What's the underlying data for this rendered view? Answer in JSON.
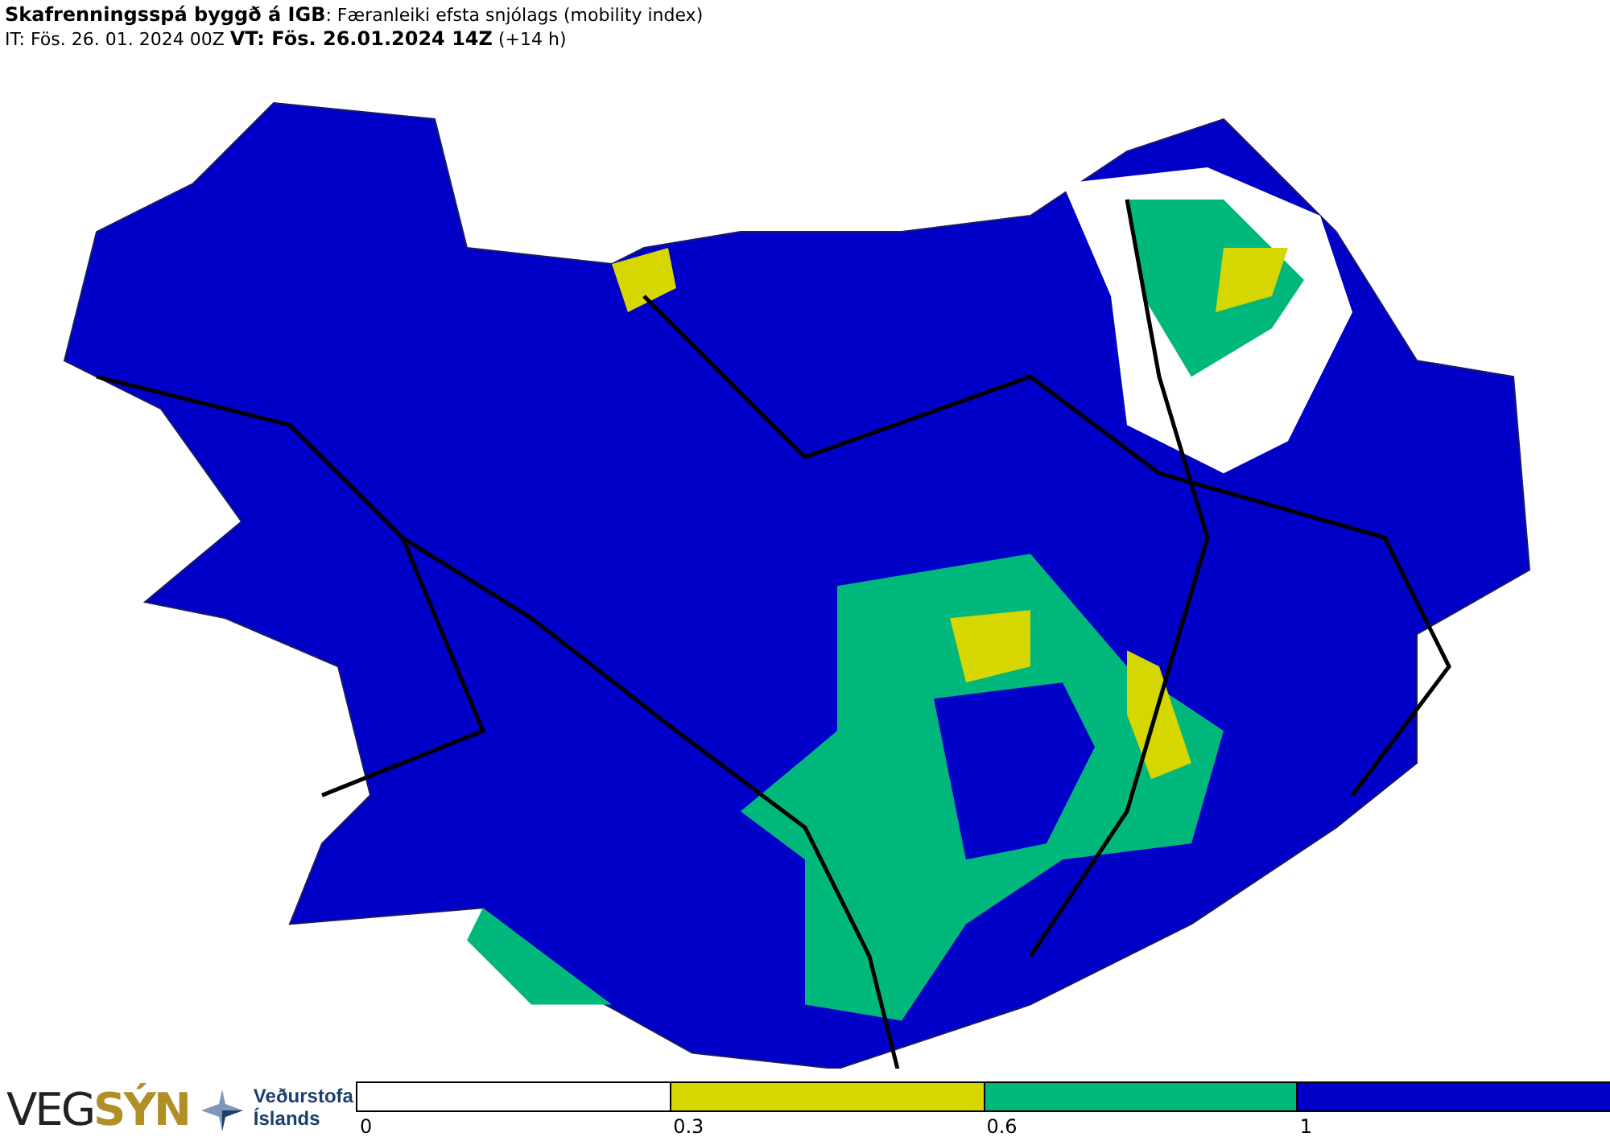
{
  "header": {
    "title": "**Skafrenningsspá byggð á IGB**: Færanleiki efsta snjólags (mobility index)",
    "times": "IT: Fös. 26. 01. 2024 00Z **VT: Fös. 26.01.2024 14Z** (+14 h)"
  },
  "logo": {
    "primary": "VEG",
    "accent": "SÝN"
  },
  "agency": {
    "line1": "Veðurstofa",
    "line2": "Íslands"
  },
  "legend": [
    {
      "label": "0",
      "color": "#ffffff"
    },
    {
      "label": "0.3",
      "color": "#d6d600"
    },
    {
      "label": "0.6",
      "color": "#00b87c"
    },
    {
      "label": "1",
      "color": "#0000c8"
    }
  ]
}
